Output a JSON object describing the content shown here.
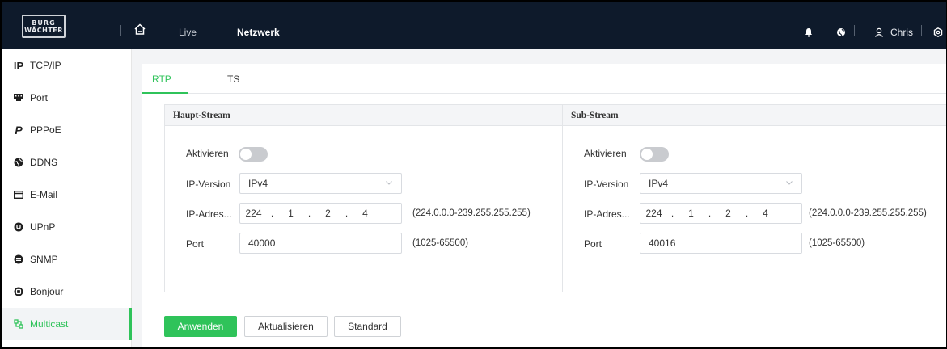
{
  "brand": {
    "line1": "BURG",
    "line2": "WÄCHTER"
  },
  "topnav": {
    "live": "Live",
    "netzwerk": "Netzwerk",
    "user": "Chris"
  },
  "sidebar": {
    "items": [
      {
        "icon": "tcpip-icon",
        "glyph": "IP",
        "label": "TCP/IP"
      },
      {
        "icon": "port-icon",
        "glyph": "",
        "label": "Port"
      },
      {
        "icon": "pppoe-icon",
        "glyph": "P",
        "label": "PPPoE"
      },
      {
        "icon": "ddns-icon",
        "glyph": "",
        "label": "DDNS"
      },
      {
        "icon": "email-icon",
        "glyph": "",
        "label": "E-Mail"
      },
      {
        "icon": "upnp-icon",
        "glyph": "",
        "label": "UPnP"
      },
      {
        "icon": "snmp-icon",
        "glyph": "",
        "label": "SNMP"
      },
      {
        "icon": "bonjour-icon",
        "glyph": "",
        "label": "Bonjour"
      },
      {
        "icon": "multicast-icon",
        "glyph": "",
        "label": "Multicast"
      }
    ]
  },
  "tabs": {
    "rtp": "RTP",
    "ts": "TS"
  },
  "main_stream": {
    "title": "Haupt-Stream",
    "enable_label": "Aktivieren",
    "ipversion_label": "IP-Version",
    "ipversion_value": "IPv4",
    "ipaddr_label": "IP-Adres...",
    "ip": [
      "224",
      "1",
      "2",
      "4"
    ],
    "ip_hint": "(224.0.0.0-239.255.255.255)",
    "port_label": "Port",
    "port_value": "40000",
    "port_hint": "(1025-65500)"
  },
  "sub_stream": {
    "title": "Sub-Stream",
    "enable_label": "Aktivieren",
    "ipversion_label": "IP-Version",
    "ipversion_value": "IPv4",
    "ipaddr_label": "IP-Adres...",
    "ip": [
      "224",
      "1",
      "2",
      "4"
    ],
    "ip_hint": "(224.0.0.0-239.255.255.255)",
    "port_label": "Port",
    "port_value": "40016",
    "port_hint": "(1025-65500)"
  },
  "buttons": {
    "apply": "Anwenden",
    "refresh": "Aktualisieren",
    "default": "Standard"
  },
  "colors": {
    "accent": "#2fc35a",
    "topbar": "#0e1a2b"
  }
}
